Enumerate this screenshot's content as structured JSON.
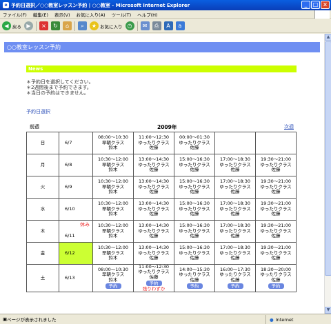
{
  "window": {
    "title": "予約日選択／○○教室レッスン予約 | ○○教室 - Microsoft Internet Explorer",
    "buttons": [
      "_",
      "□",
      "×"
    ]
  },
  "menu": [
    "ファイル(F)",
    "編集(E)",
    "表示(V)",
    "お気に入り(A)",
    "ツール(T)",
    "ヘルプ(H)"
  ],
  "toolbar": {
    "back": "戻る",
    "favorites": "お気に入り"
  },
  "page": {
    "header": "○○教室レッスン予約",
    "news_title": "News",
    "notes": [
      "＊予約日を選択してください。",
      "＊2週間後まで予約できます。",
      "＊当日の予約はできません。"
    ],
    "select_link": "予約日選択",
    "prev": "前週",
    "year": "2009年",
    "next": "次週",
    "holiday": "休み",
    "reserve": "予約",
    "few_left": "残りわずか"
  },
  "schedule": [
    {
      "weekday": "日",
      "date": "6/7",
      "color": "red",
      "slots": [
        [
          "08:00～10:30",
          "早朝クラス",
          "鈴木"
        ],
        [
          "11:00～12:30",
          "ゆったりクラス",
          "佐藤"
        ],
        [
          "00:00～01:30",
          "ゆったりクラス",
          "佐藤"
        ],
        [],
        []
      ]
    },
    {
      "weekday": "月",
      "date": "6/8",
      "color": "",
      "slots": [
        [
          "10:30～12:00",
          "早朝クラス",
          "鈴木"
        ],
        [
          "13:00～14:30",
          "ゆったりクラス",
          "佐藤"
        ],
        [
          "15:00～16:30",
          "ゆったりクラス",
          "佐藤"
        ],
        [
          "17:00～18:30",
          "ゆったりクラス",
          "佐藤"
        ],
        [
          "19:30～21:00",
          "ゆったりクラス",
          "佐藤"
        ]
      ]
    },
    {
      "weekday": "火",
      "date": "6/9",
      "color": "",
      "slots": [
        [
          "10:30～12:00",
          "早朝クラス",
          "鈴木"
        ],
        [
          "13:00～14:30",
          "ゆったりクラス",
          "佐藤"
        ],
        [
          "15:00～16:30",
          "ゆったりクラス",
          "佐藤"
        ],
        [
          "17:00～18:30",
          "ゆったりクラス",
          "佐藤"
        ],
        [
          "19:30～21:00",
          "ゆったりクラス",
          "佐藤"
        ]
      ]
    },
    {
      "weekday": "水",
      "date": "6/10",
      "color": "",
      "slots": [
        [
          "10:30～12:00",
          "早朝クラス",
          "鈴木"
        ],
        [
          "13:00～14:30",
          "ゆったりクラス",
          "佐藤"
        ],
        [
          "15:00～16:30",
          "ゆったりクラス",
          "佐藤"
        ],
        [
          "17:00～18:30",
          "ゆったりクラス",
          "佐藤"
        ],
        [
          "19:30～21:00",
          "ゆったりクラス",
          "佐藤"
        ]
      ]
    },
    {
      "weekday": "木",
      "date": "6/11",
      "color": "",
      "holiday": true,
      "slots": [
        [
          "10:30～12:00",
          "早朝クラス",
          "鈴木"
        ],
        [
          "13:00～14:30",
          "ゆったりクラス",
          "佐藤"
        ],
        [
          "15:00～16:30",
          "ゆったりクラス",
          "佐藤"
        ],
        [
          "17:00～18:30",
          "ゆったりクラス",
          "佐藤"
        ],
        [
          "19:30～21:00",
          "ゆったりクラス",
          "佐藤"
        ]
      ]
    },
    {
      "weekday": "金",
      "date": "6/12",
      "color": "",
      "highlight": true,
      "slots": [
        [
          "10:30～12:00",
          "早朝クラス",
          "鈴木"
        ],
        [
          "13:00～14:30",
          "ゆったりクラス",
          "佐藤"
        ],
        [
          "15:00～16:30",
          "ゆったりクラス",
          "佐藤"
        ],
        [
          "17:00～18:30",
          "ゆったりクラス",
          "佐藤"
        ],
        [
          "19:30～21:00",
          "ゆったりクラス",
          "佐藤"
        ]
      ]
    },
    {
      "weekday": "土",
      "date": "6/13",
      "color": "blue",
      "bookable": true,
      "slots": [
        [
          "08:00～10:30",
          "早朝クラス",
          "鈴木"
        ],
        [
          "11:00～12:30",
          "ゆったりクラス",
          "佐藤",
          "few"
        ],
        [
          "14:00～15:30",
          "ゆったりクラス",
          "佐藤"
        ],
        [
          "16:00～17:30",
          "ゆったりクラス",
          "佐藤"
        ],
        [
          "18:30～20:00",
          "ゆったりクラス",
          "佐藤"
        ]
      ]
    }
  ],
  "status": {
    "text": "ページが表示されました",
    "zone": "Internet"
  }
}
